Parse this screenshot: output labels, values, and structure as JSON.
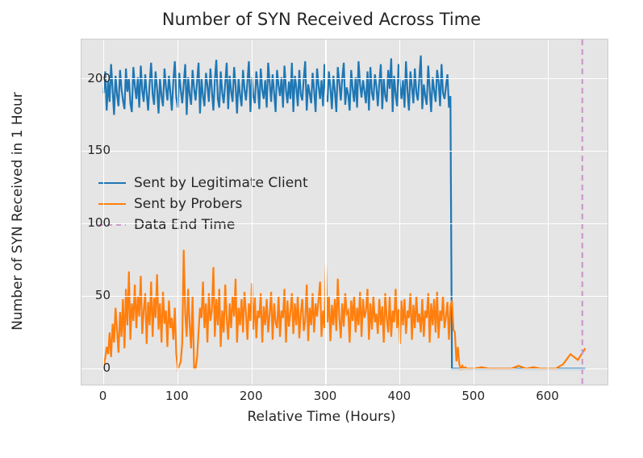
{
  "chart_data": {
    "type": "line",
    "title": "Number of SYN Received Across Time",
    "xlabel": "Relative Time (Hours)",
    "ylabel": "Number of SYN Received in 1 Hour",
    "xlim": [
      -30,
      680
    ],
    "ylim": [
      -11,
      227
    ],
    "xticks": [
      0,
      100,
      200,
      300,
      400,
      500,
      600
    ],
    "yticks": [
      0,
      50,
      100,
      150,
      200
    ],
    "vlines": [
      {
        "x": 646,
        "label": "Data End Time",
        "color": "#cc99cc",
        "style": "dashed"
      }
    ],
    "series": [
      {
        "name": "Sent by Legitimate Client",
        "color": "#1f77b4",
        "x": [
          0,
          2,
          4,
          6,
          8,
          10,
          12,
          14,
          16,
          18,
          20,
          22,
          24,
          26,
          28,
          30,
          32,
          34,
          36,
          38,
          40,
          42,
          44,
          46,
          48,
          50,
          52,
          54,
          56,
          58,
          60,
          62,
          64,
          66,
          68,
          70,
          72,
          74,
          76,
          78,
          80,
          82,
          84,
          86,
          88,
          90,
          92,
          94,
          96,
          98,
          100,
          102,
          104,
          106,
          108,
          110,
          112,
          114,
          116,
          118,
          120,
          122,
          124,
          126,
          128,
          130,
          132,
          134,
          136,
          138,
          140,
          142,
          144,
          146,
          148,
          150,
          152,
          154,
          156,
          158,
          160,
          162,
          164,
          166,
          168,
          170,
          172,
          174,
          176,
          178,
          180,
          182,
          184,
          186,
          188,
          190,
          192,
          194,
          196,
          198,
          200,
          202,
          204,
          206,
          208,
          210,
          212,
          214,
          216,
          218,
          220,
          222,
          224,
          226,
          228,
          230,
          232,
          234,
          236,
          238,
          240,
          242,
          244,
          246,
          248,
          250,
          252,
          254,
          256,
          258,
          260,
          262,
          264,
          266,
          268,
          270,
          272,
          274,
          276,
          278,
          280,
          282,
          284,
          286,
          288,
          290,
          292,
          294,
          296,
          298,
          300,
          302,
          304,
          306,
          308,
          310,
          312,
          314,
          316,
          318,
          320,
          322,
          324,
          326,
          328,
          330,
          332,
          334,
          336,
          338,
          340,
          342,
          344,
          346,
          348,
          350,
          352,
          354,
          356,
          358,
          360,
          362,
          364,
          366,
          368,
          370,
          372,
          374,
          376,
          378,
          380,
          382,
          384,
          386,
          388,
          390,
          392,
          394,
          396,
          398,
          400,
          402,
          404,
          406,
          408,
          410,
          412,
          414,
          416,
          418,
          420,
          422,
          424,
          426,
          428,
          430,
          432,
          434,
          436,
          438,
          440,
          442,
          444,
          446,
          448,
          450,
          452,
          454,
          456,
          458,
          460,
          462,
          464,
          466,
          468,
          470,
          472,
          474,
          476,
          478,
          480,
          482,
          484,
          486,
          488,
          490,
          500,
          510,
          520,
          530,
          540,
          550,
          560,
          570,
          580,
          590,
          600,
          610,
          620,
          630,
          640,
          650
        ],
        "y": [
          190,
          205,
          178,
          198,
          184,
          210,
          192,
          175,
          202,
          189,
          181,
          206,
          193,
          185,
          179,
          207,
          191,
          200,
          183,
          177,
          208,
          195,
          186,
          201,
          180,
          209,
          192,
          184,
          203,
          190,
          178,
          197,
          211,
          189,
          182,
          205,
          193,
          176,
          200,
          188,
          181,
          207,
          194,
          185,
          202,
          190,
          178,
          199,
          212,
          187,
          180,
          204,
          192,
          183,
          196,
          210,
          175,
          201,
          189,
          182,
          206,
          193,
          185,
          198,
          211,
          176,
          200,
          188,
          181,
          204,
          195,
          184,
          207,
          192,
          178,
          199,
          213,
          186,
          180,
          205,
          190,
          183,
          197,
          211,
          179,
          202,
          191,
          184,
          208,
          195,
          176,
          200,
          189,
          181,
          206,
          193,
          185,
          198,
          212,
          177,
          201,
          188,
          183,
          205,
          194,
          179,
          207,
          192,
          186,
          199,
          180,
          211,
          197,
          184,
          203,
          190,
          177,
          206,
          195,
          188,
          201,
          180,
          209,
          192,
          183,
          198,
          186,
          211,
          177,
          202,
          194,
          181,
          206,
          189,
          185,
          200,
          212,
          178,
          196,
          190,
          183,
          204,
          192,
          177,
          207,
          195,
          186,
          199,
          181,
          210,
          188,
          184,
          205,
          193,
          179,
          202,
          191,
          177,
          208,
          197,
          185,
          200,
          211,
          182,
          194,
          189,
          178,
          206,
          193,
          184,
          201,
          180,
          212,
          196,
          187,
          199,
          191,
          183,
          205,
          178,
          208,
          190,
          185,
          203,
          195,
          181,
          197,
          210,
          179,
          200,
          188,
          184,
          206,
          193,
          214,
          177,
          202,
          189,
          181,
          210,
          195,
          186,
          199,
          180,
          212,
          191,
          178,
          205,
          194,
          183,
          207,
          190,
          185,
          200,
          216,
          179,
          196,
          188,
          182,
          209,
          193,
          177,
          201,
          192,
          184,
          206,
          198,
          181,
          210,
          190,
          186,
          195,
          203,
          180,
          188,
          0,
          0,
          0,
          0,
          0,
          0,
          0,
          0,
          0,
          0,
          0,
          0,
          0,
          0,
          0,
          0,
          0,
          0,
          0,
          0,
          0,
          0,
          0,
          0,
          0,
          0,
          0
        ]
      },
      {
        "name": "Sent by Probers",
        "color": "#ff7f0e",
        "x": [
          0,
          2,
          4,
          6,
          8,
          10,
          12,
          14,
          16,
          18,
          20,
          22,
          24,
          26,
          28,
          30,
          32,
          34,
          36,
          38,
          40,
          42,
          44,
          46,
          48,
          50,
          52,
          54,
          56,
          58,
          60,
          62,
          64,
          66,
          68,
          70,
          72,
          74,
          76,
          78,
          80,
          82,
          84,
          86,
          88,
          90,
          92,
          94,
          96,
          98,
          100,
          102,
          104,
          106,
          108,
          110,
          112,
          114,
          116,
          118,
          120,
          122,
          124,
          126,
          128,
          130,
          132,
          134,
          136,
          138,
          140,
          142,
          144,
          146,
          148,
          150,
          152,
          154,
          156,
          158,
          160,
          162,
          164,
          166,
          168,
          170,
          172,
          174,
          176,
          178,
          180,
          182,
          184,
          186,
          188,
          190,
          192,
          194,
          196,
          198,
          200,
          202,
          204,
          206,
          208,
          210,
          212,
          214,
          216,
          218,
          220,
          222,
          224,
          226,
          228,
          230,
          232,
          234,
          236,
          238,
          240,
          242,
          244,
          246,
          248,
          250,
          252,
          254,
          256,
          258,
          260,
          262,
          264,
          266,
          268,
          270,
          272,
          274,
          276,
          278,
          280,
          282,
          284,
          286,
          288,
          290,
          292,
          294,
          296,
          298,
          300,
          302,
          304,
          306,
          308,
          310,
          312,
          314,
          316,
          318,
          320,
          322,
          324,
          326,
          328,
          330,
          332,
          334,
          336,
          338,
          340,
          342,
          344,
          346,
          348,
          350,
          352,
          354,
          356,
          358,
          360,
          362,
          364,
          366,
          368,
          370,
          372,
          374,
          376,
          378,
          380,
          382,
          384,
          386,
          388,
          390,
          392,
          394,
          396,
          398,
          400,
          402,
          404,
          406,
          408,
          410,
          412,
          414,
          416,
          418,
          420,
          422,
          424,
          426,
          428,
          430,
          432,
          434,
          436,
          438,
          440,
          442,
          444,
          446,
          448,
          450,
          452,
          454,
          456,
          458,
          460,
          462,
          464,
          466,
          468,
          470,
          472,
          474,
          476,
          478,
          480,
          482,
          484,
          486,
          488,
          490,
          500,
          510,
          520,
          530,
          540,
          550,
          560,
          570,
          580,
          590,
          600,
          610,
          620,
          630,
          640,
          650
        ],
        "y": [
          3,
          7,
          15,
          10,
          25,
          8,
          31,
          18,
          42,
          26,
          11,
          39,
          22,
          48,
          14,
          55,
          30,
          67,
          20,
          45,
          33,
          58,
          28,
          50,
          36,
          64,
          24,
          40,
          52,
          17,
          46,
          30,
          60,
          22,
          49,
          35,
          65,
          27,
          45,
          18,
          53,
          31,
          40,
          15,
          47,
          28,
          35,
          20,
          42,
          10,
          0,
          2,
          5,
          18,
          82,
          38,
          22,
          55,
          30,
          14,
          50,
          0,
          0,
          8,
          25,
          42,
          35,
          60,
          28,
          45,
          18,
          52,
          33,
          40,
          70,
          22,
          48,
          30,
          55,
          15,
          40,
          25,
          58,
          35,
          20,
          45,
          28,
          50,
          36,
          62,
          18,
          42,
          30,
          48,
          25,
          53,
          38,
          20,
          45,
          33,
          59,
          27,
          49,
          21,
          40,
          35,
          52,
          18,
          43,
          30,
          48,
          25,
          38,
          53,
          20,
          45,
          32,
          28,
          50,
          22,
          40,
          35,
          55,
          18,
          47,
          29,
          39,
          52,
          24,
          45,
          30,
          50,
          21,
          38,
          48,
          26,
          33,
          58,
          19,
          42,
          30,
          52,
          25,
          45,
          36,
          48,
          60,
          22,
          40,
          28,
          72,
          32,
          50,
          19,
          44,
          30,
          48,
          26,
          62,
          35,
          21,
          45,
          29,
          52,
          38,
          40,
          18,
          47,
          33,
          50,
          25,
          42,
          30,
          53,
          22,
          48,
          35,
          40,
          55,
          20,
          45,
          27,
          50,
          32,
          38,
          24,
          48,
          30,
          43,
          18,
          52,
          35,
          25,
          50,
          22,
          40,
          32,
          55,
          28,
          41,
          17,
          47,
          30,
          48,
          24,
          40,
          35,
          52,
          20,
          44,
          28,
          50,
          32,
          38,
          25,
          48,
          22,
          40,
          35,
          52,
          18,
          45,
          30,
          48,
          25,
          53,
          21,
          40,
          33,
          50,
          28,
          36,
          46,
          20,
          43,
          47,
          27,
          25,
          5,
          15,
          3,
          0,
          2,
          0,
          1,
          0,
          0,
          1,
          0,
          0,
          0,
          0,
          2,
          0,
          1,
          0,
          0,
          0,
          3,
          10,
          6,
          14
        ]
      }
    ],
    "legend": {
      "position": "center left",
      "entries": [
        "Sent by Legitimate Client",
        "Sent by Probers",
        "Data End Time"
      ]
    }
  },
  "colors": {
    "series1": "#1f77b4",
    "series2": "#ff7f0e",
    "vline": "#cc99cc"
  }
}
